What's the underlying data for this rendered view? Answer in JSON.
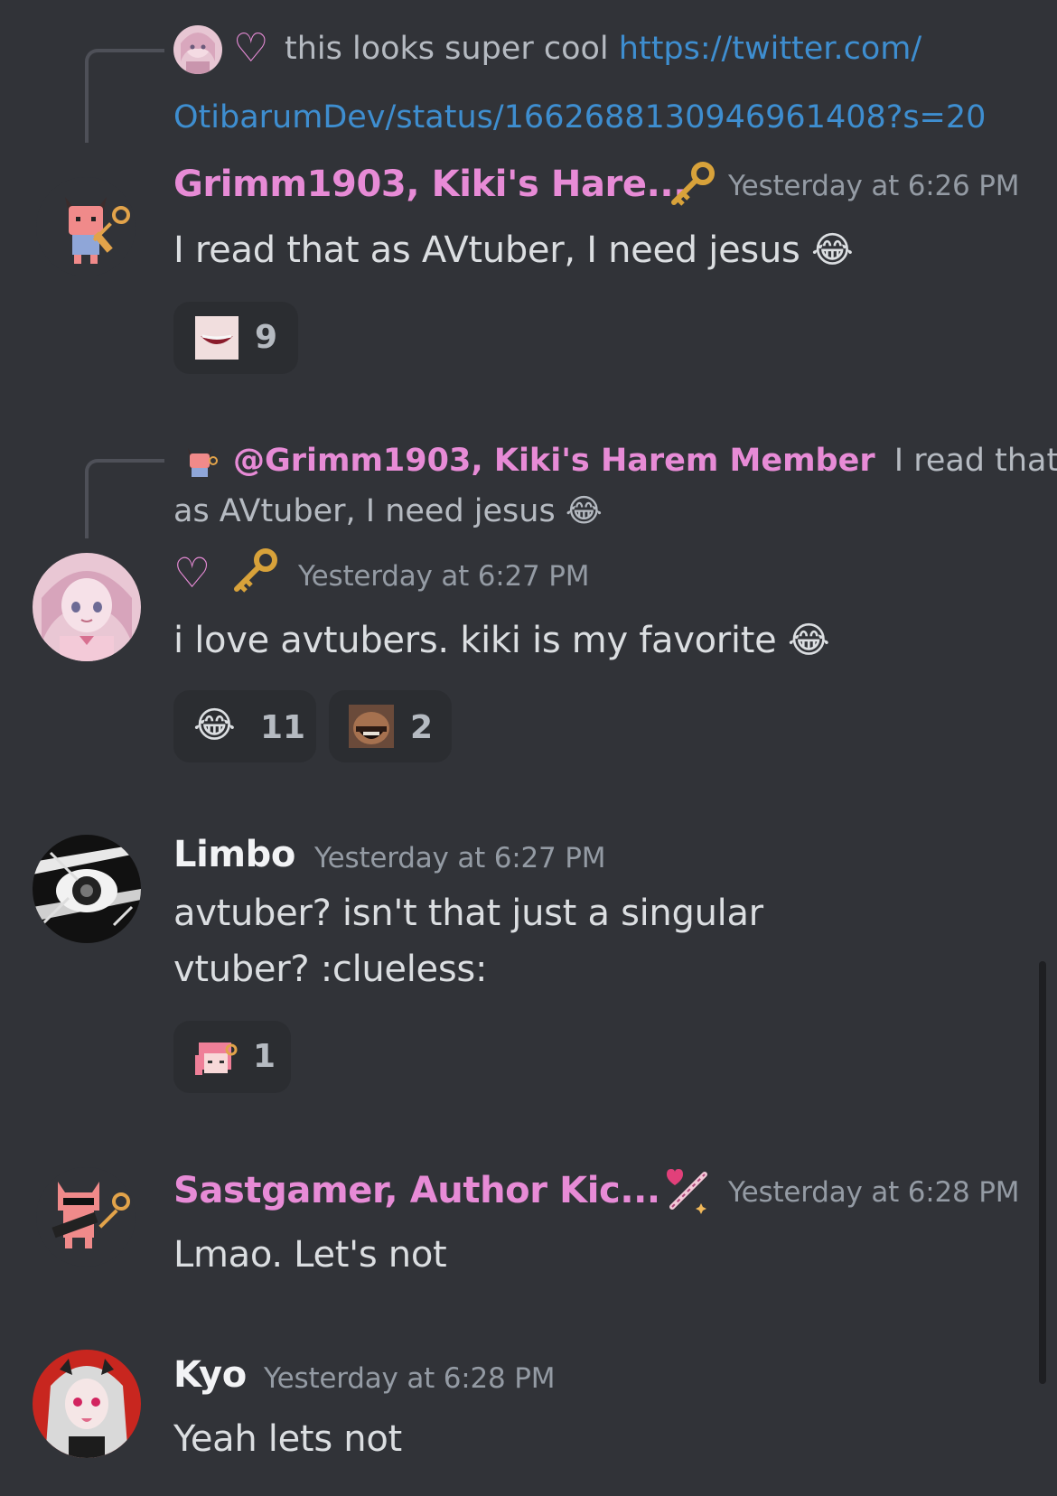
{
  "colors": {
    "background": "#313338",
    "username_pink": "#e78bd6",
    "username_white": "#f2f3f5",
    "timestamp": "#949ba4",
    "link": "#3e8ed0",
    "reaction_bg": "#2b2d31"
  },
  "messages": [
    {
      "reply": {
        "heart": "♡",
        "text": "this looks super cool",
        "link_line1": "https://twitter.com/",
        "link_line2": "OtibarumDev/status/1662688130946961408?s=20"
      },
      "username": "Grimm1903, Kiki's Hare...",
      "badge_icon": "golden-key-icon",
      "timestamp": "Yesterday at 6:26 PM",
      "text": "I read that as AVtuber, I need jesus",
      "text_emoji": "😂",
      "reactions": [
        {
          "emoji": "lips-emote",
          "count": "9"
        }
      ]
    },
    {
      "reply": {
        "mention": "@Grimm1903, Kiki's Harem Member",
        "text_line1": "I read that",
        "text_line2": "as AVtuber, I need jesus",
        "emoji": "😂"
      },
      "username": "♡",
      "badge_icon": "golden-key-icon",
      "timestamp": "Yesterday at 6:27 PM",
      "text": "i love avtubers. kiki is my favorite",
      "text_emoji": "😂",
      "reactions": [
        {
          "emoji": "😂",
          "count": "11"
        },
        {
          "emoji": "laughing-man-emote",
          "count": "2"
        }
      ]
    },
    {
      "username": "Limbo",
      "timestamp": "Yesterday at 6:27 PM",
      "text_line1": "avtuber? isn't that just a singular",
      "text_line2": "vtuber? :clueless:",
      "reactions": [
        {
          "emoji": "pink-pixel-girl-emote",
          "count": "1"
        }
      ]
    },
    {
      "username": "Sastgamer, Author Kic...",
      "badge_icon": "magic-wand-heart-icon",
      "timestamp": "Yesterday at 6:28 PM",
      "text": "Lmao. Let's not"
    },
    {
      "username": "Kyo",
      "timestamp": "Yesterday at 6:28 PM",
      "text": "Yeah lets not"
    }
  ]
}
